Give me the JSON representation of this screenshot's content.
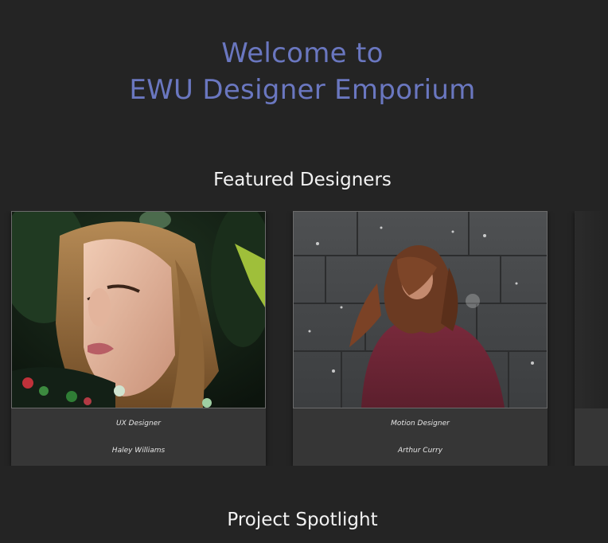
{
  "hero": {
    "line1": "Welcome to",
    "line2": "EWU Designer Emporium"
  },
  "featured": {
    "heading": "Featured Designers",
    "designers": [
      {
        "role": "UX Designer",
        "name": "Haley Williams"
      },
      {
        "role": "Motion Designer",
        "name": "Arthur Curry"
      },
      {
        "role": "",
        "name": ""
      }
    ]
  },
  "spotlight": {
    "heading": "Project Spotlight"
  },
  "colors": {
    "background": "#242424",
    "hero_text": "#6a77c0",
    "heading_text": "#f2f2f2",
    "card": "#363636"
  }
}
